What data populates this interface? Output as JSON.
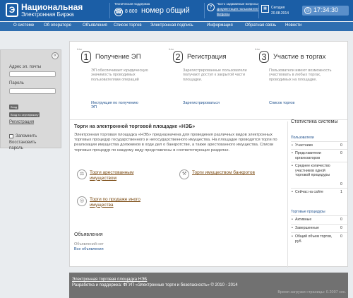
{
  "header": {
    "logo_mark": "Э",
    "logo_line1": "Национальная",
    "logo_line2": "Электронная Биржа",
    "support_label": "Техническая поддержка",
    "phone_prefix": "8 800",
    "phone_number": "номер общий",
    "faq_label": "Часто задаваемые вопросы",
    "faq_link1": "Документация пользователя",
    "faq_link2": "Вопросы",
    "date_label": "Сегодня",
    "date_value": "20.08.2014",
    "time_value": "17:34:30"
  },
  "nav": [
    "О системе",
    "Об операторе",
    "Объявления",
    "Список торгов",
    "Электронная подпись",
    "Информация",
    "Обратная связь",
    "Новости"
  ],
  "login": {
    "email_label": "Адрес эл. почты",
    "password_label": "Пароль",
    "login_button": "Вход",
    "cert_button": "Вход по сертификату",
    "register_link": "Регистрация",
    "remember_label": "Запомнить",
    "restore_link1": "Восстановить",
    "restore_link2": "пароль"
  },
  "cards": [
    {
      "corner": "Шаг",
      "num": "1",
      "title": "Получение ЭП",
      "desc": "ЭП обеспечивает юридическую значимость проводимых пользователями операций",
      "link": "Инструкция по получению ЭП"
    },
    {
      "corner": "Шаг",
      "num": "2",
      "title": "Регистрация",
      "desc": "Зарегистрированные пользователи получают доступ к закрытой части площадки.",
      "link": "Зарегистрироваться"
    },
    {
      "corner": "Шаг",
      "num": "3",
      "title": "Участие в торгах",
      "desc": "Пользователи имеют возможность участвовать в любых торгах, проводимых на площадке.",
      "link": "Список торгов"
    }
  ],
  "section": {
    "title": "Торги на электронной торговой площадке «НЭБ»",
    "text": "Электронная торговая площадка «НЭБ» предназначена для проведения различных видов электронных торговых процедур государственного и негосударственного имущества. На площадке проводятся торги по реализации имущества должников в ходе дел о банкротстве, а также арестованного имущества. Списки торговых процедур по каждому виду представлены в соответствующих разделах."
  },
  "trade_links": [
    "Торги арестованным имуществом",
    "Торги имуществом банкротов",
    "Торги по продаже иного имущества"
  ],
  "stats": {
    "title": "Статистика системы",
    "users_label": "Пользователи",
    "users": [
      {
        "label": "Участники",
        "value": "0"
      },
      {
        "label": "Представители организаторов",
        "value": "0"
      },
      {
        "label": "Среднее количество участников одной торговой процедуры",
        "value": "0"
      },
      {
        "label": "Сейчас на сайте",
        "value": "1"
      }
    ],
    "trades_label": "Торговые процедуры",
    "trades": [
      {
        "label": "Активные",
        "value": "0"
      },
      {
        "label": "Завершенные",
        "value": "0"
      },
      {
        "label": "Общий объем торгов, руб.",
        "value": "0"
      }
    ]
  },
  "announcements": {
    "title": "Объявления",
    "empty_text": "Объявлений нет",
    "all_link": "Все объявления"
  },
  "footer": {
    "line1": "Электронная торговая площадка НЭБ",
    "line2": "Разработка и поддержка: ФГУП «Электронные торги и безопасность» © 2010 - 2014",
    "line3": "Время загрузки страницы: 0.2097 сек."
  }
}
